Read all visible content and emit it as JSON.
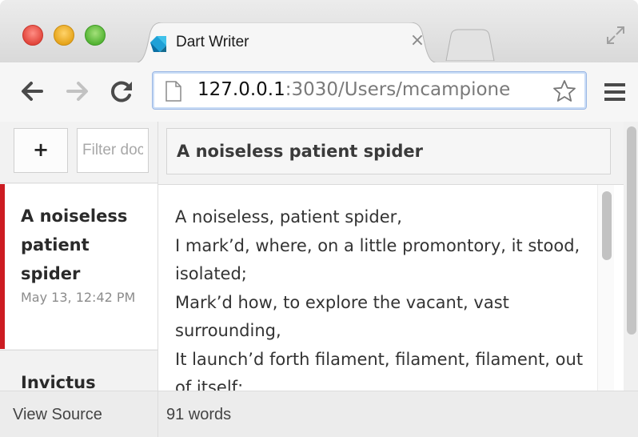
{
  "browser": {
    "tab": {
      "title": "Dart Writer",
      "close_glyph": "×"
    },
    "address_bar": {
      "host": "127.0.0.1",
      "rest": ":3030/Users/mcampione"
    },
    "menu_icon": "hamburger-menu-icon"
  },
  "app": {
    "sidebar": {
      "add_button_label": "+",
      "filter_placeholder": "Filter docs",
      "documents": [
        {
          "title": "A noiseless patient spider",
          "date": "May 13, 12:42 PM",
          "selected": true
        },
        {
          "title": "Invictus",
          "date": "",
          "selected": false
        }
      ]
    },
    "editor": {
      "title": "A noiseless patient spider",
      "body": "A noiseless, patient spider,\nI mark’d, where, on a little promontory, it stood, isolated;\nMark’d how, to explore the vacant, vast surrounding,\nIt launch’d forth filament, filament, filament, out of itself;"
    },
    "status": {
      "view_source_label": "View Source",
      "word_count": "91 words"
    },
    "colors": {
      "selected_accent": "#cc1c22",
      "url_focus": "#9bb7e4"
    }
  }
}
